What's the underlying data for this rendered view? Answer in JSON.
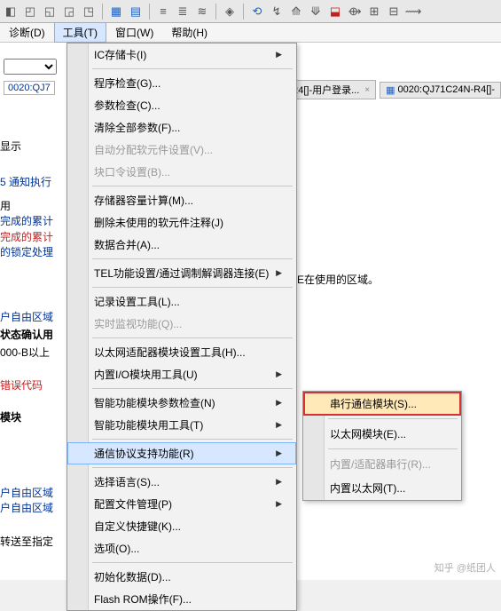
{
  "menubar": {
    "diagnose": "诊断(D)",
    "tools": "工具(T)",
    "window": "窗口(W)",
    "help": "帮助(H)"
  },
  "toolbar_icons": [
    "◧",
    "◰",
    "◱",
    "◲",
    "◳",
    "▦",
    "▤",
    "≡",
    "≣",
    "≋",
    "◈",
    "│",
    "⟲",
    "↯",
    "⟰",
    "⟱",
    "⬓",
    "⟴",
    "⊞",
    "⊟",
    "⟿"
  ],
  "tabbar": {
    "label": "0020:QJ7",
    "tab1": "R4[]-用户登录...",
    "tab2": "0020:QJ71C24N-R4[]-"
  },
  "background": {
    "xianshi": "显示",
    "t5": "5 通知执行",
    "yong": "用",
    "wancheng1": "完成的累计",
    "wancheng2": "完成的累计",
    "suoding": "的锁定处理",
    "ziyou1": "户自由区域",
    "zhuangtai": "状态确认用",
    "ooob": "000-B以上",
    "cuowu": "错误代码",
    "mokuai": "模块",
    "ziyou2": "户自由区域",
    "ziyou3": "户自由区域",
    "zhuansong": "转送至指定",
    "using": "E在使用的区域。"
  },
  "menu": {
    "items": [
      {
        "label": "IC存储卡(I)",
        "arrow": true
      },
      {
        "sep": true
      },
      {
        "label": "程序检查(G)..."
      },
      {
        "label": "参数检查(C)..."
      },
      {
        "label": "清除全部参数(F)..."
      },
      {
        "label": "自动分配软元件设置(V)...",
        "disabled": true
      },
      {
        "label": "块口令设置(B)...",
        "disabled": true
      },
      {
        "sep": true
      },
      {
        "label": "存储器容量计算(M)..."
      },
      {
        "label": "删除未使用的软元件注释(J)"
      },
      {
        "label": "数据合并(A)..."
      },
      {
        "sep": true
      },
      {
        "label": "TEL功能设置/通过调制解调器连接(E)",
        "arrow": true
      },
      {
        "sep": true
      },
      {
        "label": "记录设置工具(L)..."
      },
      {
        "label": "实时监视功能(Q)...",
        "disabled": true
      },
      {
        "sep": true
      },
      {
        "label": "以太网适配器模块设置工具(H)..."
      },
      {
        "label": "内置I/O模块用工具(U)",
        "arrow": true
      },
      {
        "sep": true
      },
      {
        "label": "智能功能模块参数检查(N)",
        "arrow": true
      },
      {
        "label": "智能功能模块用工具(T)",
        "arrow": true
      },
      {
        "sep": true
      },
      {
        "label": "通信协议支持功能(R)",
        "arrow": true,
        "hover": true
      },
      {
        "sep": true
      },
      {
        "label": "选择语言(S)...",
        "arrow": true
      },
      {
        "label": "配置文件管理(P)",
        "arrow": true
      },
      {
        "label": "自定义快捷键(K)..."
      },
      {
        "label": "选项(O)..."
      },
      {
        "sep": true
      },
      {
        "label": "初始化数据(D)..."
      },
      {
        "label": "Flash ROM操作(F)..."
      }
    ]
  },
  "submenu": {
    "items": [
      {
        "label": "串行通信模块(S)...",
        "highlight": true
      },
      {
        "sep": true
      },
      {
        "label": "以太网模块(E)..."
      },
      {
        "sep": true
      },
      {
        "label": "内置/适配器串行(R)...",
        "disabled": true
      },
      {
        "label": "内置以太网(T)..."
      }
    ]
  },
  "watermark": "知乎 @纸团人"
}
